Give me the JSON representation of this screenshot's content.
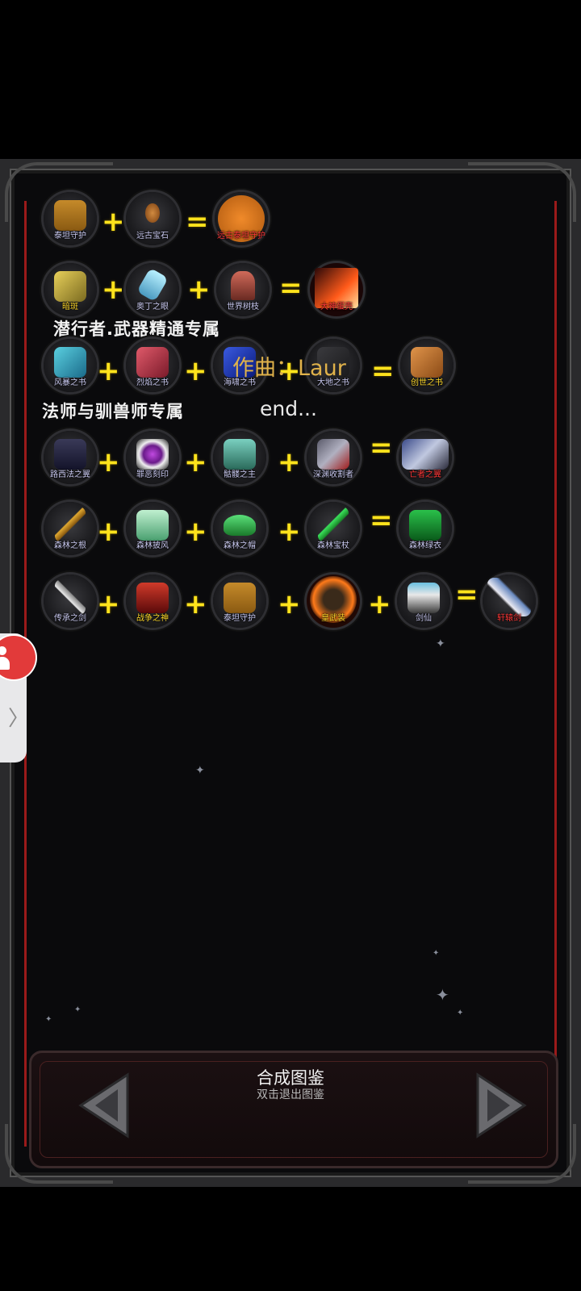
{
  "recipes": [
    {
      "items": [
        "泰坦守护",
        "远古宝石",
        "远古泰坦守护"
      ],
      "ops": [
        "+",
        "="
      ]
    },
    {
      "items": [
        "暗斑",
        "奥丁之眼",
        "世界树枝",
        "大神蛋壳"
      ],
      "ops": [
        "+",
        "+",
        "="
      ]
    },
    {
      "items": [
        "风暴之书",
        "烈焰之书",
        "海啸之书",
        "大地之书",
        "创世之书"
      ],
      "ops": [
        "+",
        "+",
        "+",
        "="
      ]
    },
    {
      "items": [
        "路西法之翼",
        "罪恶刻印",
        "骷髅之主",
        "深渊收割者",
        "亡者之翼"
      ],
      "ops": [
        "+",
        "+",
        "+",
        "="
      ]
    },
    {
      "items": [
        "森林之根",
        "森林披风",
        "森林之帽",
        "森林宝杖",
        "森林绿衣"
      ],
      "ops": [
        "+",
        "+",
        "+",
        "="
      ]
    },
    {
      "items": [
        "传承之剑",
        "战争之神",
        "泰坦守护",
        "皇武装",
        "剑仙",
        "轩辕剑"
      ],
      "ops": [
        "+",
        "+",
        "+",
        "+",
        "="
      ]
    }
  ],
  "notes": {
    "row2": "潜行者.武器精通专属",
    "row3": "法师与驯兽师专属"
  },
  "overlay": {
    "credit": "作曲：Laur",
    "end": "end..."
  },
  "bottom": {
    "title": "合成图鉴",
    "hint": "双击退出图鉴"
  },
  "colors": {
    "operator": "#ffe31c",
    "label": "#c9c9f0",
    "result_label": "#ff3838",
    "frame_red": "#9a1a1a"
  }
}
